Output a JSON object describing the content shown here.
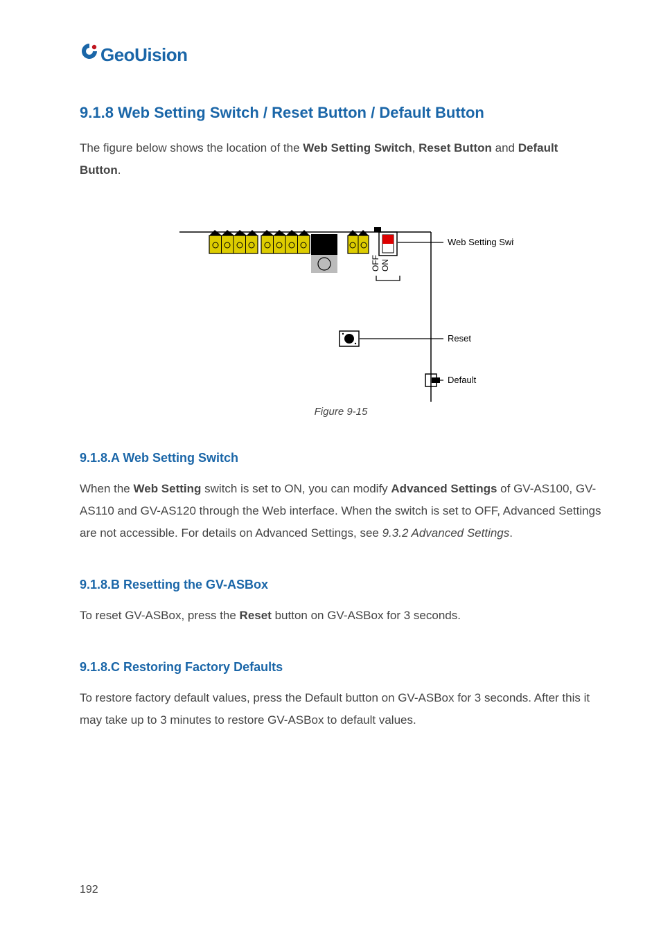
{
  "logo": {
    "text": "GeoUision"
  },
  "section_top": {
    "heading": "9.1.8  Web Setting Switch / Reset Button / Default Button",
    "intro_pre": "The figure below shows the location of the ",
    "intro_bold1": "Web Setting Switch",
    "intro_mid": ", ",
    "intro_bold2": "Reset Button",
    "intro_and": " and ",
    "intro_bold3": "Default Button",
    "intro_end": "."
  },
  "diagram": {
    "on": "ON",
    "off": "OFF",
    "label_right": "Web Setting Switch",
    "label_reset": "Reset",
    "label_default": "Default"
  },
  "figure_caption": "Figure 9-15",
  "section_web": {
    "heading": "9.1.8.A  Web Setting Switch",
    "t1": "When the ",
    "b1": "Web Setting",
    "t2": " switch is set to ON, you can modify ",
    "b2": "Advanced Settings",
    "t3": " of GV-AS100, GV-AS110 and GV-AS120 through the Web interface. When the switch is set to OFF, Advanced Settings are not accessible. For details on Advanced Settings, see ",
    "ref": "9.3.2 Advanced Settings",
    "t4": "."
  },
  "section_reset": {
    "heading": "9.1.8.B  Resetting the GV-ASBox",
    "t1": "To reset GV-ASBox, press the ",
    "b1": "Reset",
    "t2": " button on GV-ASBox for 3 seconds."
  },
  "section_default": {
    "heading": "9.1.8.C  Restoring Factory Defaults",
    "t1": "To restore factory default values, press the Default button on GV-ASBox for 3 seconds. After this it may take up to 3 minutes to restore GV-ASBox to default values."
  },
  "page_number": "192"
}
